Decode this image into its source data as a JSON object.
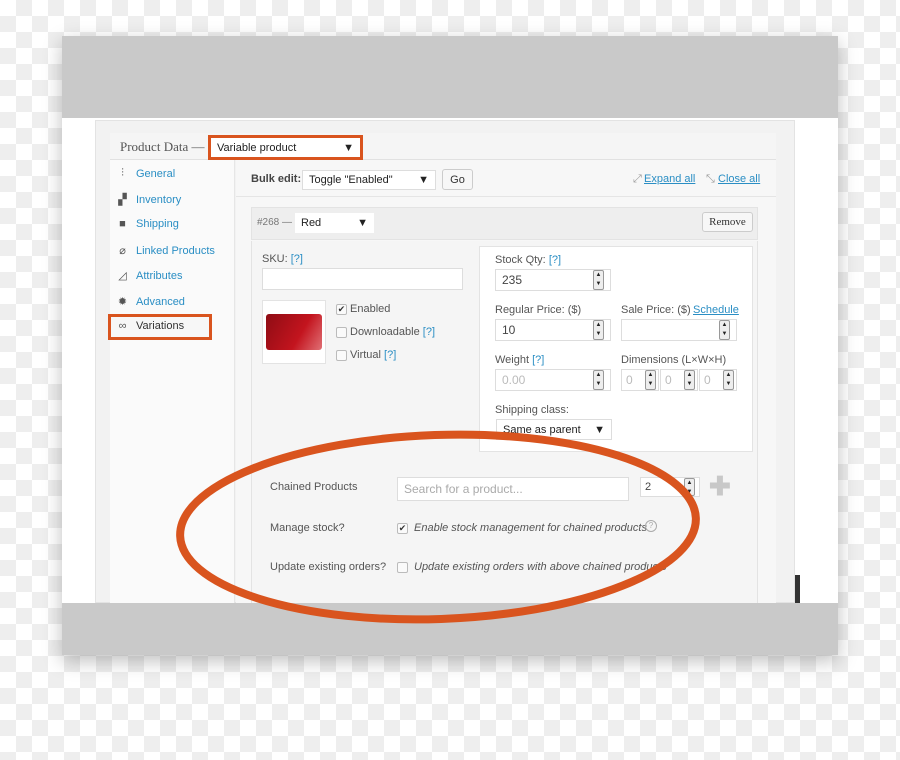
{
  "header": {
    "title": "Product Data —",
    "product_type": "Variable product"
  },
  "sidebar": {
    "items": [
      {
        "label": "General",
        "icon": "sliders-icon"
      },
      {
        "label": "Inventory",
        "icon": "boxes-icon"
      },
      {
        "label": "Shipping",
        "icon": "truck-icon"
      },
      {
        "label": "Linked Products",
        "icon": "link-icon"
      },
      {
        "label": "Attributes",
        "icon": "triangle-ruler-icon"
      },
      {
        "label": "Advanced",
        "icon": "gear-icon"
      },
      {
        "label": "Variations",
        "icon": "infinity-icon"
      }
    ]
  },
  "bulk": {
    "label": "Bulk edit:",
    "value": "Toggle \"Enabled\"",
    "go": "Go",
    "expand": "Expand all",
    "close": "Close all"
  },
  "variation": {
    "id": "#268 —",
    "attribute": "Red",
    "remove": "Remove",
    "sku_label": "SKU:",
    "help": "[?]",
    "sku": "",
    "enabled": "Enabled",
    "downloadable": "Downloadable",
    "virtual": "Virtual",
    "stock_label": "Stock Qty:",
    "stock": "235",
    "regular_label": "Regular Price: ($)",
    "regular": "10",
    "sale_label": "Sale Price: ($)",
    "schedule": "Schedule",
    "sale": "",
    "weight_label": "Weight",
    "weight_placeholder": "0.00",
    "dims_label": "Dimensions (L×W×H)",
    "dim_placeholder": "0",
    "shipping_label": "Shipping class:",
    "shipping": "Same as parent"
  },
  "chained": {
    "label": "Chained Products",
    "placeholder": "Search for a product...",
    "qty": "2",
    "manage_label": "Manage stock?",
    "manage_text": "Enable stock management for chained products",
    "update_label": "Update existing orders?",
    "update_text": "Update existing orders with above chained products"
  },
  "colors": {
    "highlight": "#d9541e",
    "link": "#2a8ec4"
  }
}
